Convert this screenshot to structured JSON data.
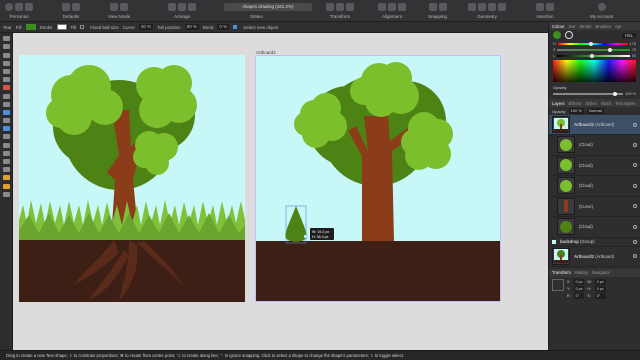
{
  "toolbar": {
    "groups": [
      {
        "label": "Personas"
      },
      {
        "label": "Defaults"
      },
      {
        "label": "View Mode"
      },
      {
        "label": "Arrange"
      },
      {
        "label": "Stateo"
      },
      {
        "label": "Transform"
      },
      {
        "label": "Alignment"
      },
      {
        "label": "Snapping"
      },
      {
        "label": "Geometry"
      },
      {
        "label": "Insertion"
      },
      {
        "label": "My Account"
      }
    ],
    "document_title": "shapes drawing (161.2%)"
  },
  "context": {
    "tool_name": "Tear",
    "fill_label": "Fill",
    "fill_color": "#3f8f1f",
    "stroke_label": "Stroke",
    "curve_label": "Curve",
    "curve_value": "30 %",
    "tail_label": "Tail position",
    "tail_value": "50 %",
    "bend_label": "Bend",
    "bend_value": "0 %",
    "fixed_label": "Fixed ball size",
    "select_new_label": "Select new object"
  },
  "canvas": {
    "artboard1_label": "Artboard1",
    "artboard2_label": "Artboard2",
    "measure_width": "W: 19.2 px",
    "measure_height": "H: 36.3 px"
  },
  "panel": {
    "top_tabs": [
      "Colour",
      "Swt",
      "Stroke",
      "Brushes",
      "Apr"
    ],
    "mode_value": "HSL",
    "slider_values": [
      "176",
      "75",
      "50"
    ],
    "opacity_label": "Opacity",
    "opacity_value": "100 %",
    "layer_tabs": [
      "Layers",
      "Effects",
      "Styles",
      "Stock",
      "Text Styles"
    ],
    "layer_opacity_label": "Opacity",
    "layer_opacity_value": "100 %",
    "blend_mode": "Normal",
    "layers": [
      {
        "name": "Artboard1",
        "type": "(Artboard)"
      },
      {
        "name": "",
        "type": "(Cloud)"
      },
      {
        "name": "",
        "type": "(Cloud)"
      },
      {
        "name": "",
        "type": "(Cloud)"
      },
      {
        "name": "",
        "type": "(Curve)"
      },
      {
        "name": "",
        "type": "(Cloud)"
      },
      {
        "name": "backdrop",
        "type": "(Group)"
      },
      {
        "name": "Artboard2",
        "type": "(Artboard)"
      }
    ],
    "transform_tabs": [
      "Transform",
      "History",
      "Navigator"
    ],
    "transform_fields": [
      "X:",
      "Y:",
      "W:",
      "H:",
      "R:",
      "S:"
    ],
    "transform_values": [
      "0 px",
      "0 px",
      "0 px",
      "0 px",
      "0°",
      "0°"
    ]
  },
  "status": {
    "text": "Drag to create a new Tear shape; ⇧ to constrain proportions; ⌘ to create from centre point; ⌥ to create along line; ⌃ to ignore snapping. Click to select a shape to change the shape's parameters; ⇧ to toggle select."
  },
  "colors": {
    "sky": "#c8f7f7",
    "leaf_light": "#7bbf2c",
    "leaf_dark": "#4c8314",
    "trunk": "#8b3d1a",
    "soil": "#3d1f16",
    "grass": "#80c13a",
    "accent": "#4a90d9"
  }
}
